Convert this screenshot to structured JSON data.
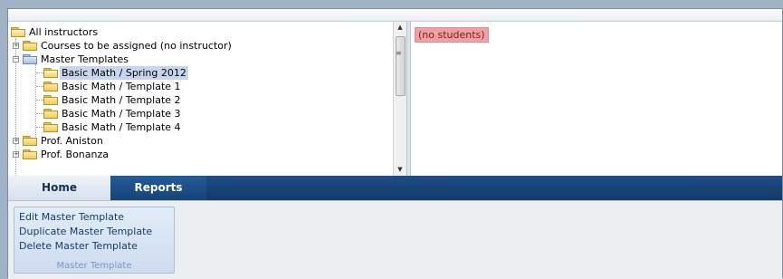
{
  "tree": {
    "items": [
      {
        "label": "All instructors"
      },
      {
        "label": "Courses to be assigned (no instructor)"
      },
      {
        "label": "Master Templates"
      },
      {
        "label": "Basic Math / Spring 2012"
      },
      {
        "label": "Basic Math / Template 1"
      },
      {
        "label": "Basic Math / Template 2"
      },
      {
        "label": "Basic Math / Template 3"
      },
      {
        "label": "Basic Math / Template 4"
      },
      {
        "label": "Prof. Aniston"
      },
      {
        "label": "Prof. Bonanza"
      }
    ],
    "selected": "Basic Math / Spring 2012"
  },
  "right_pane": {
    "empty_text": "(no students)"
  },
  "ribbon": {
    "tabs": [
      {
        "label": "Home",
        "active": true
      },
      {
        "label": "Reports",
        "active": false
      }
    ],
    "group": {
      "title": "Master Template",
      "commands": [
        "Edit Master Template",
        "Duplicate Master Template",
        "Delete Master Template"
      ]
    }
  },
  "colors": {
    "ribbon_dark": "#1b4e86",
    "selection": "#c7d6ef",
    "no_students_bg": "#f0a0a0"
  }
}
